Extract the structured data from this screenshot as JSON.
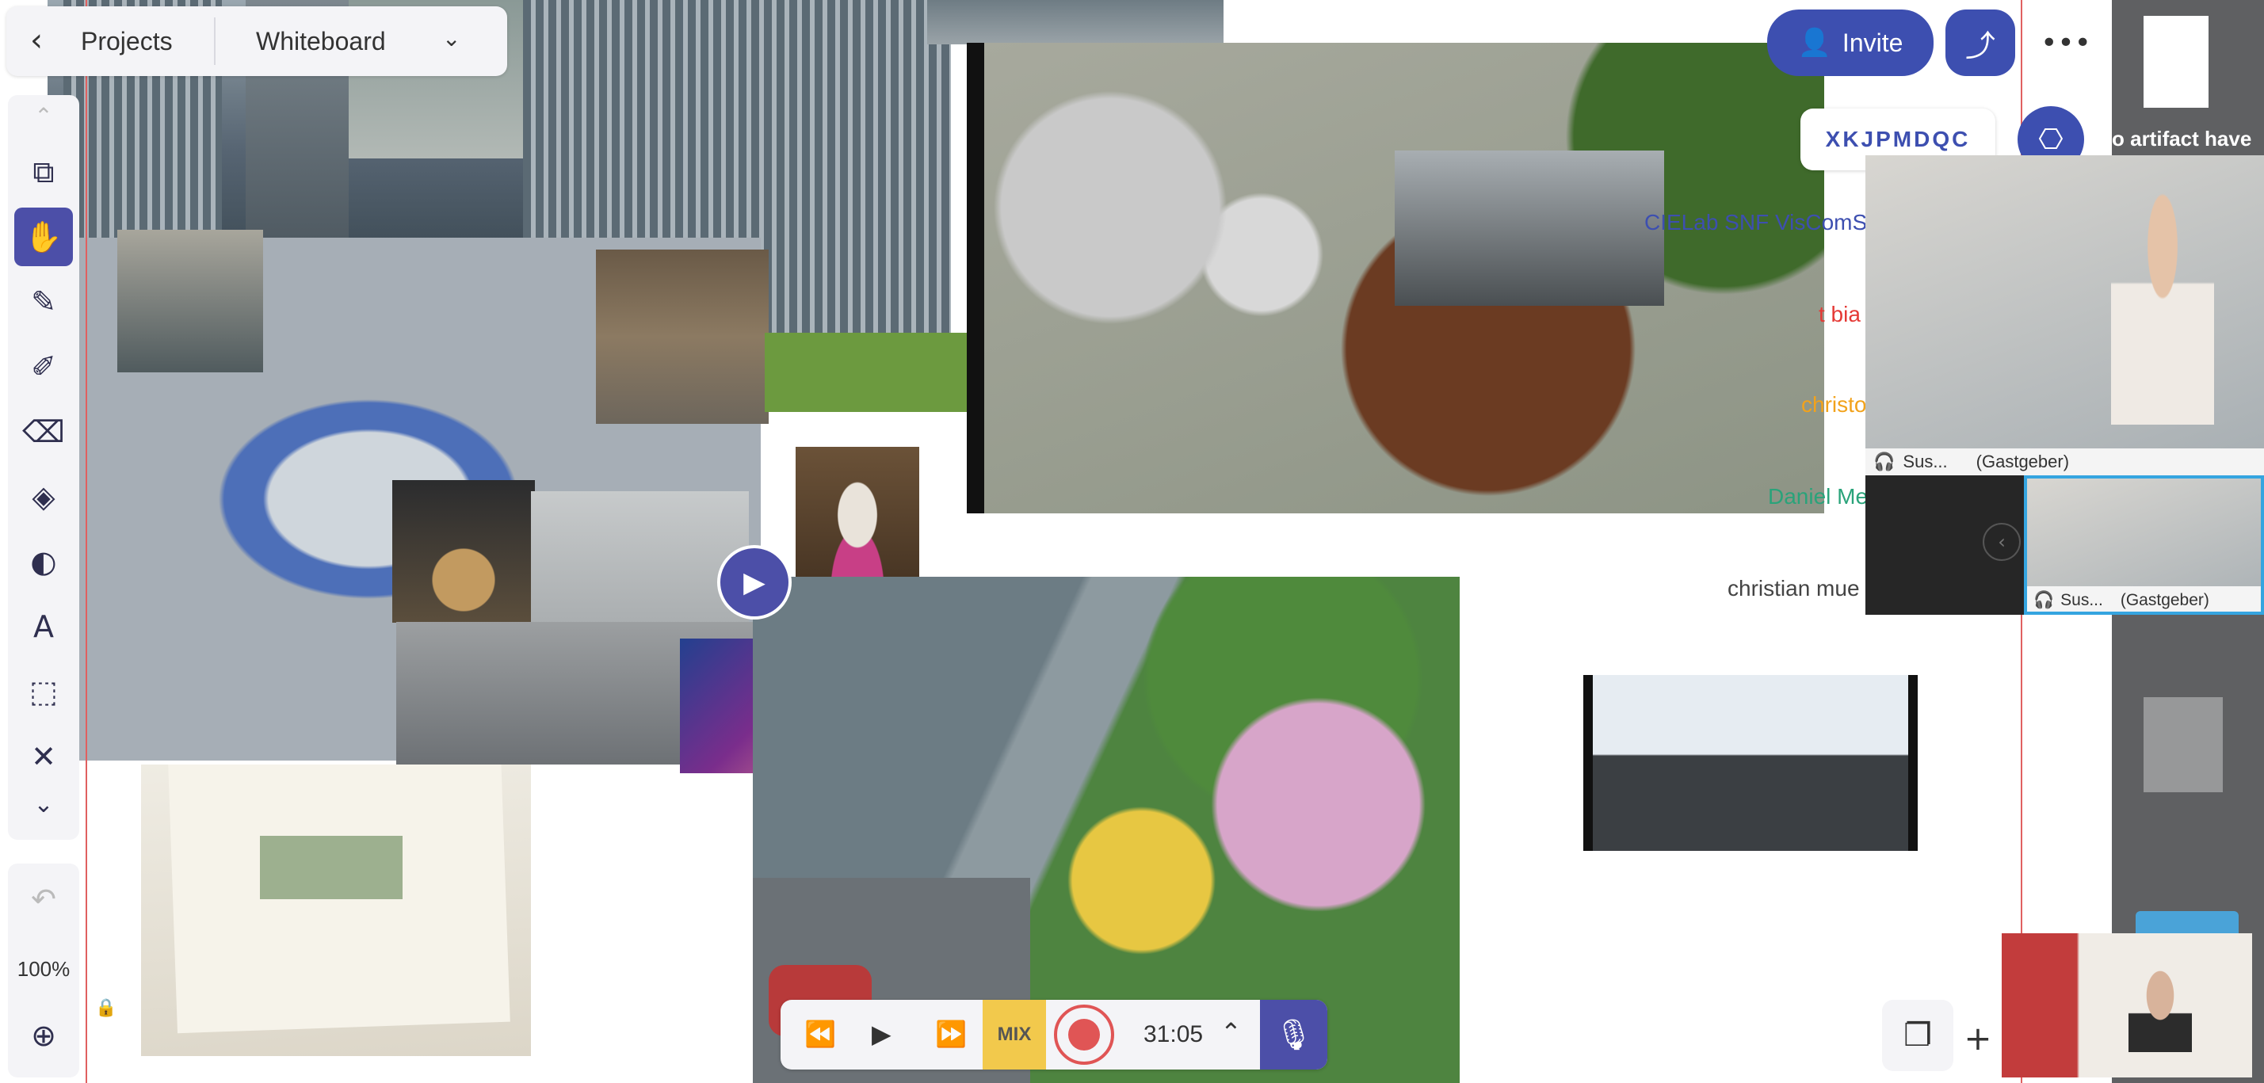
{
  "header": {
    "back_label": "Projects",
    "board_name": "Whiteboard"
  },
  "top_right": {
    "invite_label": "Invite",
    "code": "XKJPMDQC",
    "colors": {
      "accent": "#3d4fb0"
    }
  },
  "tools": [
    {
      "name": "duplicate-icon"
    },
    {
      "name": "hand-icon",
      "active": true
    },
    {
      "name": "pencil-icon"
    },
    {
      "name": "marker-icon"
    },
    {
      "name": "eraser-icon"
    },
    {
      "name": "fill-icon"
    },
    {
      "name": "shapes-icon"
    },
    {
      "name": "text-icon"
    },
    {
      "name": "selection-icon"
    },
    {
      "name": "close-icon"
    },
    {
      "name": "chevron-down-icon"
    }
  ],
  "zoom": {
    "value": "100%"
  },
  "participants_list": [
    {
      "label": "CIELab SNF VisComSto",
      "color": "#3d4fb0"
    },
    {
      "label": "t bia",
      "color": "#e53935"
    },
    {
      "label": "christo",
      "color": "#f2a21b"
    },
    {
      "label": "Daniel Me",
      "color": "#2aa37a"
    },
    {
      "label": "christian mue",
      "color": "#444444"
    }
  ],
  "video": {
    "main": {
      "name": "Sus...",
      "role": "(Gastgeber)"
    },
    "second": {
      "name": "Sus...",
      "role": "(Gastgeber)"
    }
  },
  "sidebar": {
    "snippet": "o artifact have"
  },
  "recorder": {
    "mix_label": "MIX",
    "time": "31:05"
  }
}
